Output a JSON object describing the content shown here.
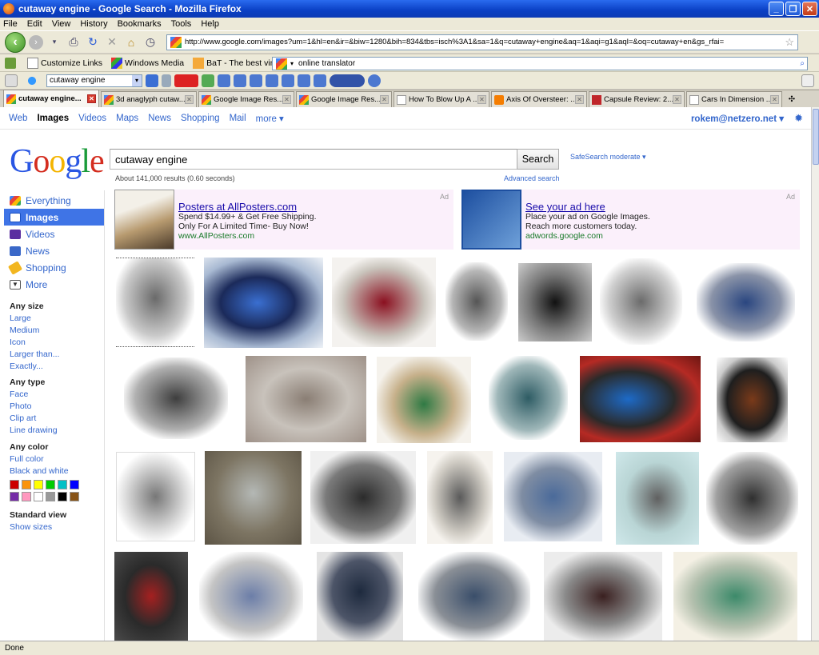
{
  "window": {
    "title": "cutaway engine - Google Search - Mozilla Firefox"
  },
  "menu": [
    "File",
    "Edit",
    "View",
    "History",
    "Bookmarks",
    "Tools",
    "Help"
  ],
  "url": "http://www.google.com/images?um=1&hl=en&ir=&biw=1280&bih=834&tbs=isch%3A1&sa=1&q=cutaway+engine&aq=1&aqi=g1&aql=&oq=cutaway+en&gs_rfai=",
  "bookmarks": {
    "items": [
      "Customize Links",
      "Windows Media",
      "BaT - The best vintag..."
    ],
    "search_value": "online translator"
  },
  "toolbar2": {
    "search_value": "cutaway engine"
  },
  "tabs": [
    {
      "label": "cutaway engine..."
    },
    {
      "label": "3d anaglyph cutaw..."
    },
    {
      "label": "Google Image Res..."
    },
    {
      "label": "Google Image Res..."
    },
    {
      "label": "How To Blow Up A ..."
    },
    {
      "label": "Axis Of Oversteer: ..."
    },
    {
      "label": "Capsule Review: 2..."
    },
    {
      "label": "Cars In Dimension ..."
    }
  ],
  "gbar": {
    "links": [
      "Web",
      "Images",
      "Videos",
      "Maps",
      "News",
      "Shopping",
      "Mail",
      "more ▾"
    ],
    "account": "rokem@netzero.net ▾"
  },
  "search": {
    "query": "cutaway engine",
    "button": "Search",
    "safesearch": "SafeSearch moderate ▾",
    "stats": "About 141,000 results (0.60 seconds)",
    "advanced": "Advanced search"
  },
  "leftnav": {
    "items": [
      "Everything",
      "Images",
      "Videos",
      "News",
      "Shopping",
      "More"
    ]
  },
  "filters": {
    "size": {
      "heading": "Any size",
      "options": [
        "Large",
        "Medium",
        "Icon",
        "Larger than...",
        "Exactly..."
      ]
    },
    "type": {
      "heading": "Any type",
      "options": [
        "Face",
        "Photo",
        "Clip art",
        "Line drawing"
      ]
    },
    "color": {
      "heading": "Any color",
      "options": [
        "Full color",
        "Black and white"
      ]
    },
    "view": {
      "heading": "Standard view",
      "options": [
        "Show sizes"
      ]
    }
  },
  "swatches": [
    "#cc0000",
    "#fb940b",
    "#ffff00",
    "#00cc00",
    "#03c0c6",
    "#0000ff",
    "#762ca7",
    "#ff98bf",
    "#ffffff",
    "#999999",
    "#000000",
    "#885418"
  ],
  "ads": [
    {
      "title": "Posters at AllPosters.com",
      "line1": "Spend $14.99+ & Get Free Shipping.",
      "line2": "Only For A Limited Time- Buy Now!",
      "url": "www.AllPosters.com",
      "tag": "Ad"
    },
    {
      "title": "See your ad here",
      "line1": "Place your ad on Google Images.",
      "line2": "Reach more customers today.",
      "url": "adwords.google.com",
      "tag": "Ad"
    }
  ],
  "status": "Done"
}
